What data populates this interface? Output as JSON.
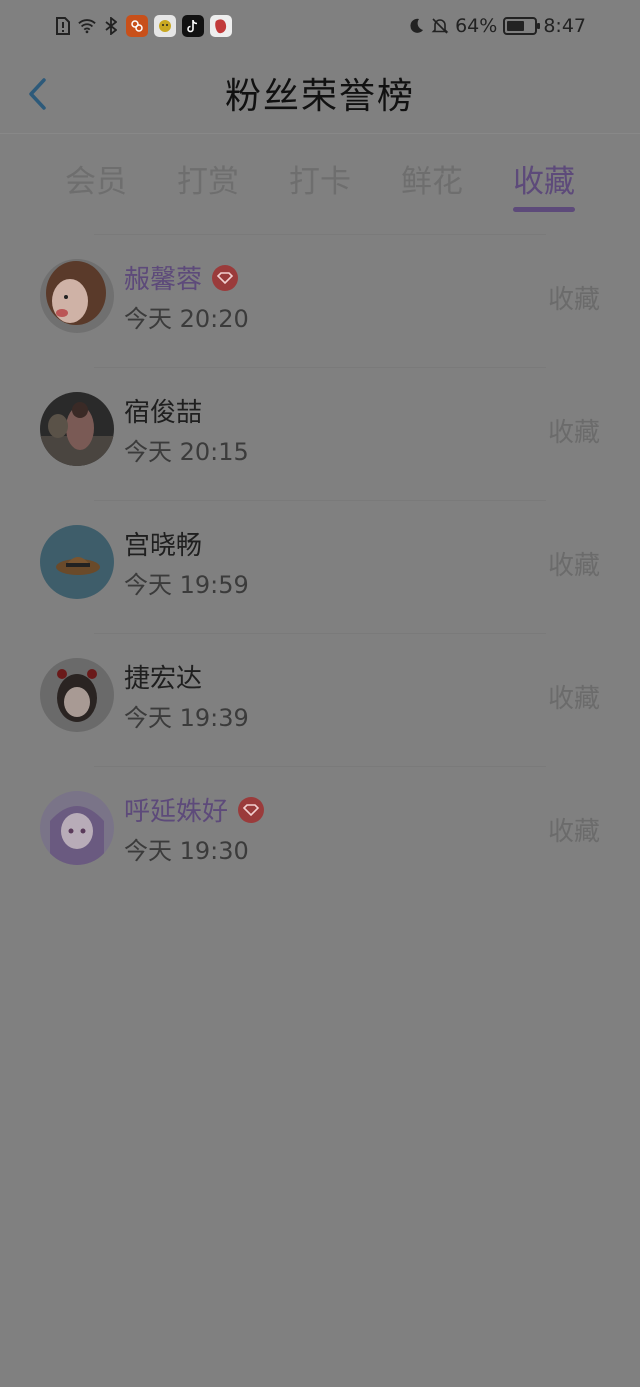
{
  "status_bar": {
    "battery_percent_text": "64%",
    "battery_level": 0.64,
    "time": "8:47",
    "left_icons": [
      "sim-alert-icon",
      "wifi-icon",
      "bluetooth-icon",
      "app-icon-orange",
      "app-icon-yellow",
      "tiktok-icon",
      "app-icon-red"
    ],
    "right_icons": [
      "moon-icon",
      "bell-muted-icon"
    ]
  },
  "header": {
    "title": "粉丝荣誉榜"
  },
  "tabs": [
    {
      "label": "会员",
      "active": false
    },
    {
      "label": "打赏",
      "active": false
    },
    {
      "label": "打卡",
      "active": false
    },
    {
      "label": "鲜花",
      "active": false
    },
    {
      "label": "收藏",
      "active": true
    }
  ],
  "fans": [
    {
      "name": "赧馨蓉",
      "vip": true,
      "time": "今天 20:20",
      "action": "收藏",
      "avatar": "cartoon-girl"
    },
    {
      "name": "宿俊喆",
      "vip": false,
      "time": "今天 20:15",
      "action": "收藏",
      "avatar": "photo-figure"
    },
    {
      "name": "宫晓畅",
      "vip": false,
      "time": "今天 19:59",
      "action": "收藏",
      "avatar": "straw-hat"
    },
    {
      "name": "捷宏达",
      "vip": false,
      "time": "今天 19:39",
      "action": "收藏",
      "avatar": "girl-with-bows"
    },
    {
      "name": "呼延姝好",
      "vip": true,
      "time": "今天 19:30",
      "action": "收藏",
      "avatar": "anime-girl"
    }
  ],
  "colors": {
    "accent": "#5d4a7a",
    "background": "#808080",
    "vip_badge": "#9a3b3b"
  }
}
